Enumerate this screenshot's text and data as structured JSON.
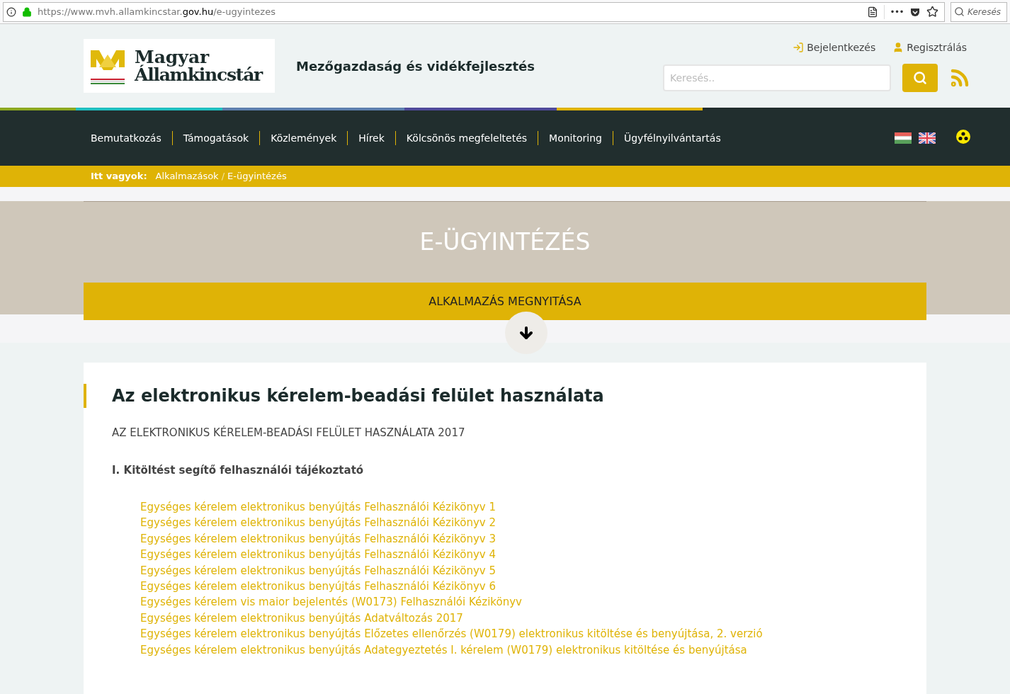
{
  "browser": {
    "url": {
      "prefix": "https://www.mvh.allamkincstar.",
      "domain": "gov.hu",
      "path": "/e-ugyintezes"
    },
    "menu_dots": "•••",
    "search_placeholder": "Keresés"
  },
  "header": {
    "logo": {
      "line_1": "Magyar",
      "line_2": "Államkincstár"
    },
    "tagline": "Mezőgazdaság és vidékfejlesztés",
    "login": "Bejelentkezés",
    "register": "Regisztrálás",
    "search_placeholder": "Keresés.."
  },
  "nav": {
    "items": [
      "Bemutatkozás",
      "Támogatások",
      "Közlemények",
      "Hírek",
      "Kölcsönös megfeleltetés",
      "Monitoring",
      "Ügyfélnyilvántartás"
    ]
  },
  "breadcrumb": {
    "label": "Itt vagyok:",
    "items": [
      "Alkalmazások",
      "E-ügyintézés"
    ],
    "separator": "/"
  },
  "hero": {
    "title": "E-ÜGYINTÉZÉS",
    "button": "ALKALMAZÁS MEGNYITÁSA"
  },
  "article": {
    "heading": "Az elektronikus kérelem-beadási felület használata",
    "subtitle": "AZ ELEKTRONIKUS KÉRELEM-BEADÁSI FELÜLET HASZNÁLATA 2017",
    "section": "I. Kitöltést segítő felhasználói tájékoztató",
    "links": [
      "Egységes kérelem elektronikus benyújtás Felhasználói Kézikönyv 1",
      "Egységes kérelem elektronikus benyújtás Felhasználói Kézikönyv 2",
      "Egységes kérelem elektronikus benyújtás Felhasználói Kézikönyv 3",
      "Egységes kérelem elektronikus benyújtás Felhasználói Kézikönyv 4",
      "Egységes kérelem elektronikus benyújtás Felhasználói Kézikönyv 5",
      "Egységes kérelem elektronikus benyújtás Felhasználói Kézikönyv 6",
      "Egységes kérelem vis maior bejelentés (W0173) Felhasználói Kézikönyv",
      "Egységes kérelem elektronikus benyújtás Adatváltozás 2017",
      "Egységes kérelem elektronikus benyújtás Előzetes ellenőrzés (W0179) elektronikus kitöltése és benyújtása, 2. verzió",
      "Egységes kérelem elektronikus benyújtás Adategyeztetés I. kérelem (W0179) elektronikus kitöltése és benyújtása"
    ]
  }
}
